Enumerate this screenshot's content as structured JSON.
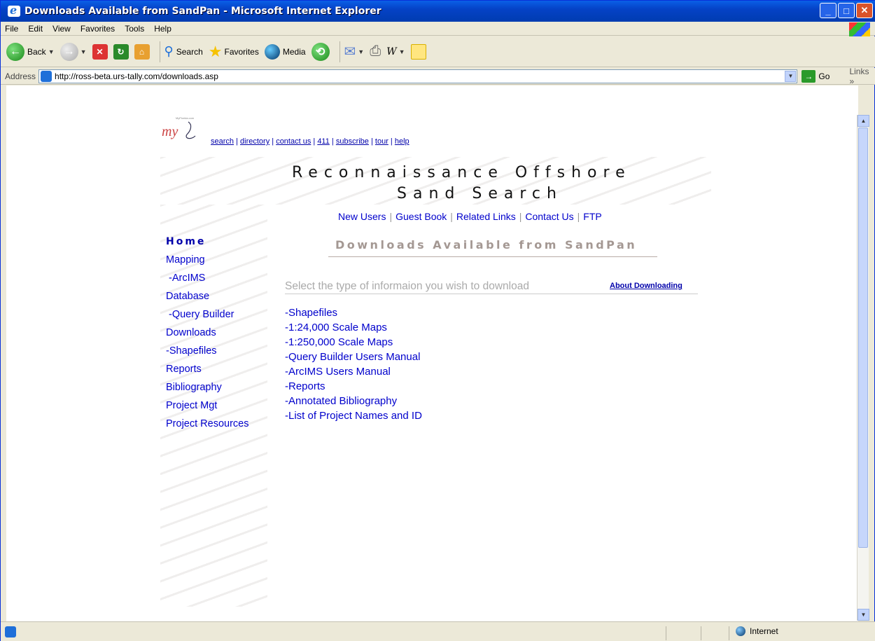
{
  "window": {
    "title": "Downloads Available from SandPan - Microsoft Internet Explorer"
  },
  "menu": [
    "File",
    "Edit",
    "View",
    "Favorites",
    "Tools",
    "Help"
  ],
  "toolbar": {
    "back": "Back",
    "search": "Search",
    "favorites": "Favorites",
    "media": "Media"
  },
  "address": {
    "label": "Address",
    "url": "http://ross-beta.urs-tally.com/downloads.asp",
    "go": "Go",
    "links": "Links"
  },
  "page": {
    "logo_small": "MyFlorida.com",
    "logo_text": "my",
    "top_links": [
      "search",
      "directory",
      "contact us",
      "411",
      "subscribe",
      "tour",
      "help"
    ],
    "banner_line1": "Reconnaissance Offshore",
    "banner_line2": "Sand Search",
    "nav_links": [
      "New Users",
      "Guest Book",
      "Related Links",
      "Contact Us",
      "FTP"
    ],
    "title": "Downloads Available from SandPan",
    "select_prompt": "Select the type of informaion you wish to download",
    "about_link": "About Downloading",
    "sidebar": [
      {
        "label": "Home",
        "style": "home"
      },
      {
        "label": "Mapping"
      },
      {
        "label": "-ArcIMS",
        "sub": true
      },
      {
        "label": "Database"
      },
      {
        "label": "-Query Builder",
        "sub": true
      },
      {
        "label": "Downloads"
      },
      {
        "label": "-Shapefiles"
      },
      {
        "label": "Reports"
      },
      {
        "label": "Bibliography"
      },
      {
        "label": "Project Mgt"
      },
      {
        "label": "Project Resources"
      }
    ],
    "downloads": [
      "-Shapefiles",
      "-1:24,000 Scale Maps",
      "-1:250,000 Scale Maps",
      "-Query Builder Users Manual",
      "-ArcIMS Users Manual",
      "-Reports",
      "-Annotated Bibliography",
      "-List of Project Names and ID"
    ]
  },
  "status": {
    "zone": "Internet"
  }
}
